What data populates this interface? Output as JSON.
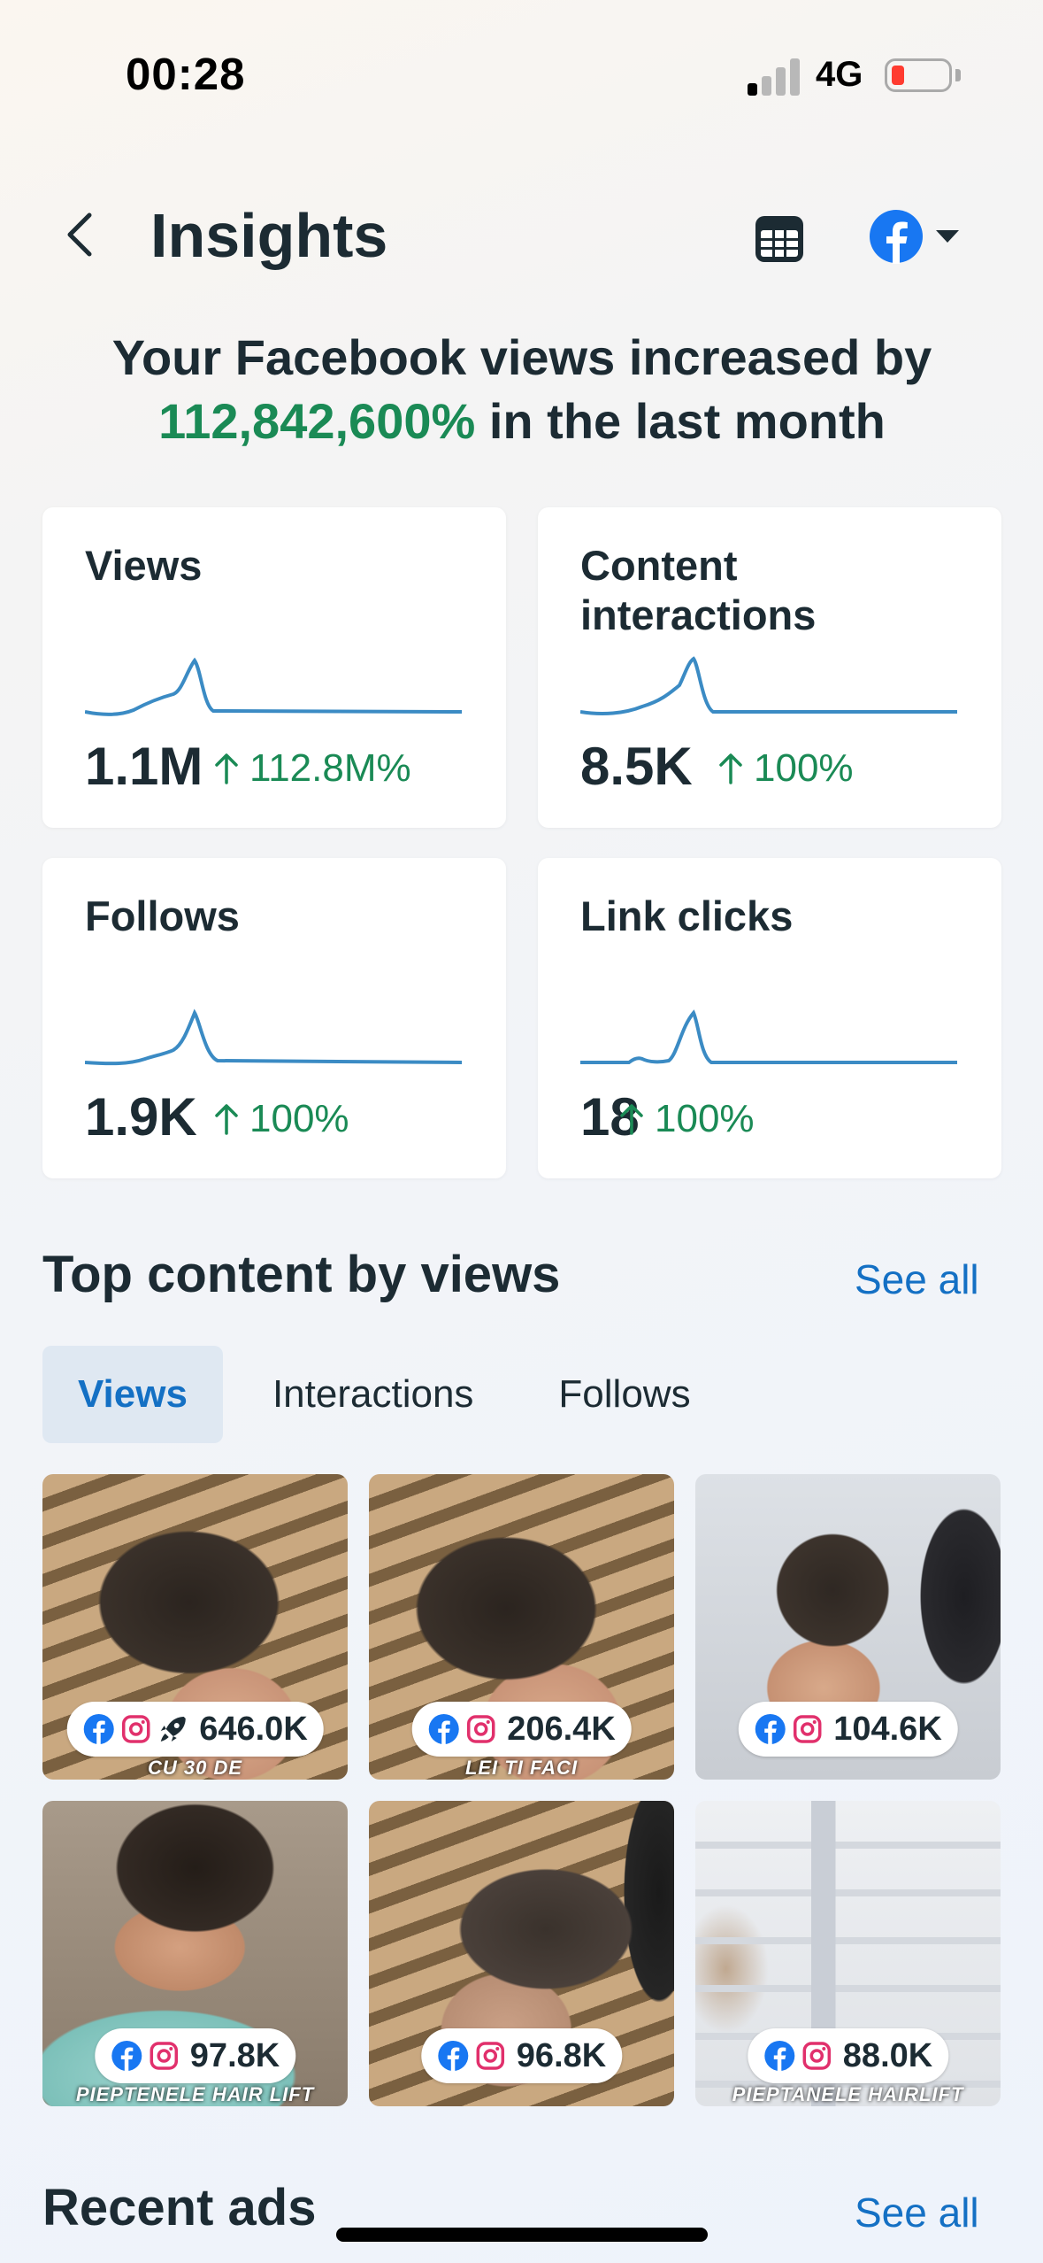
{
  "status_bar": {
    "time": "00:28",
    "network": "4G"
  },
  "header": {
    "title": "Insights"
  },
  "headline": {
    "prefix": "Your Facebook views increased by",
    "percent": "112,842,600%",
    "suffix": "in the last month"
  },
  "metrics": [
    {
      "title": "Views",
      "value": "1.1M",
      "change": "112.8M%"
    },
    {
      "title": "Content interactions",
      "value": "8.5K",
      "change": "100%"
    },
    {
      "title": "Follows",
      "value": "1.9K",
      "change": "100%"
    },
    {
      "title": "Link clicks",
      "value": "18",
      "change": "100%"
    }
  ],
  "top_content": {
    "title": "Top content by views",
    "see_all": "See all",
    "tabs": [
      "Views",
      "Interactions",
      "Follows"
    ],
    "active_tab": "Views",
    "items": [
      {
        "value": "646.0K",
        "caption": "CU 30 DE",
        "boosted": true
      },
      {
        "value": "206.4K",
        "caption": "LEI TI FACI",
        "boosted": false
      },
      {
        "value": "104.6K",
        "caption": "",
        "boosted": false
      },
      {
        "value": "97.8K",
        "caption": "PIEPTENELE HAIR LIFT",
        "boosted": false
      },
      {
        "value": "96.8K",
        "caption": "",
        "boosted": false
      },
      {
        "value": "88.0K",
        "caption": "PIEPTANELE HAIRLIFT",
        "boosted": false
      }
    ]
  },
  "recent_ads": {
    "title": "Recent ads",
    "see_all": "See all"
  },
  "colors": {
    "accent": "#1470c4",
    "positive": "#1a8a55",
    "facebook": "#1877f2",
    "sparkline": "#3b8bc4"
  },
  "icons": [
    "chevron-left-icon",
    "calendar-icon",
    "facebook-icon",
    "caret-down-icon",
    "instagram-icon",
    "rocket-icon",
    "arrow-up-icon"
  ]
}
